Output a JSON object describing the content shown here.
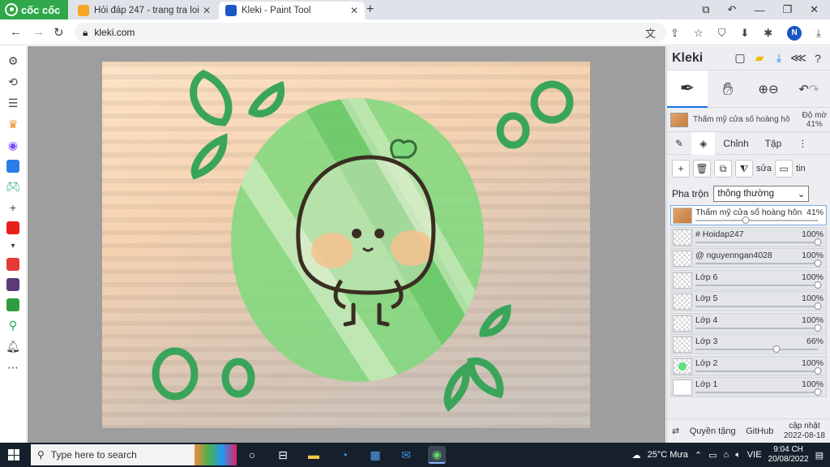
{
  "browser": {
    "brand": "cốc cốc",
    "tabs": [
      {
        "title": "Hỏi đáp 247 - trang tra loi",
        "active": false,
        "favicon_color": "#f6a623"
      },
      {
        "title": "Kleki - Paint Tool",
        "active": true,
        "favicon_color": "#1a56c4"
      }
    ],
    "url": "kleki.com",
    "avatar_letter": "N"
  },
  "kleki": {
    "app_name": "Kleki",
    "brush_name": "Thẩm mỹ cửa sổ hoàng hô",
    "opacity_label": "Độ mờ",
    "opacity_value": "41%",
    "tabs": [
      "Chỉnh",
      "Tập"
    ],
    "layer_actions": [
      "sửa",
      "tin"
    ],
    "blend_label": "Pha trộn",
    "blend_value": "thông thường",
    "layers": [
      {
        "name": "Thẩm mỹ cửa sổ hoàng hôn",
        "opacity": "41%",
        "opacity_value": 0.41,
        "thumb": "img",
        "selected": true
      },
      {
        "name": "# Hoidap247",
        "opacity": "100%",
        "opacity_value": 1.0,
        "thumb": "check",
        "selected": false
      },
      {
        "name": "@ nguyenngan4028",
        "opacity": "100%",
        "opacity_value": 1.0,
        "thumb": "check",
        "selected": false
      },
      {
        "name": "Lớp 6",
        "opacity": "100%",
        "opacity_value": 1.0,
        "thumb": "check",
        "selected": false
      },
      {
        "name": "Lớp 5",
        "opacity": "100%",
        "opacity_value": 1.0,
        "thumb": "check",
        "selected": false
      },
      {
        "name": "Lớp 4",
        "opacity": "100%",
        "opacity_value": 1.0,
        "thumb": "check",
        "selected": false
      },
      {
        "name": "Lớp 3",
        "opacity": "66%",
        "opacity_value": 0.66,
        "thumb": "check",
        "selected": false
      },
      {
        "name": "Lớp 2",
        "opacity": "100%",
        "opacity_value": 1.0,
        "thumb": "green",
        "selected": false
      },
      {
        "name": "Lớp 1",
        "opacity": "100%",
        "opacity_value": 1.0,
        "thumb": "plain",
        "selected": false
      }
    ],
    "footer": {
      "privacy": "Quyền tặng",
      "github": "GitHub",
      "update_label": "cập nhật",
      "update_date": "2022-08-18"
    }
  },
  "taskbar": {
    "search_placeholder": "Type here to search",
    "weather": "25°C  Mưa",
    "language": "VIE",
    "time": "9:04 CH",
    "date": "20/08/2022"
  },
  "colors": {
    "accent": "#1a73e8",
    "brand_green": "#2fa74a",
    "drawing_green": "#3aa55a",
    "taskbar": "#16202c"
  }
}
